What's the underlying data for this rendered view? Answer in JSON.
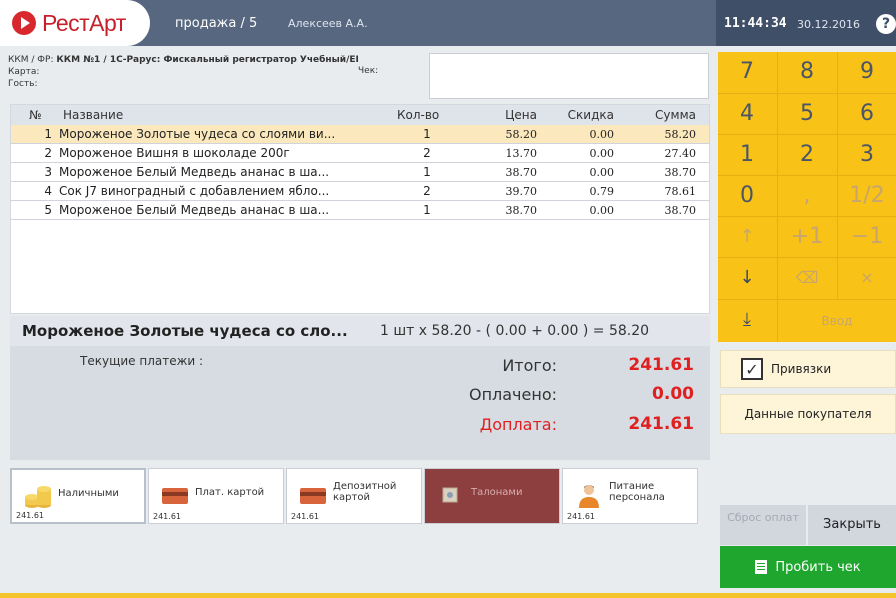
{
  "app": {
    "logo": "РестАрт",
    "mode": "продажа / 5",
    "cashier": "Алексеев А.А.",
    "time": "11:44:34",
    "date": "30.12.2016",
    "help": "?"
  },
  "info": {
    "kkm_label": "ККМ / ФР:",
    "kkm_value": "ККМ №1 / 1С-Рарус: Фискальный регистратор Учебный/EI",
    "card_label": "Карта:",
    "guest_label": "Гость:",
    "check_label": "Чек:"
  },
  "table": {
    "headers": [
      "№",
      "Название",
      "Кол-во",
      "Цена",
      "Скидка",
      "Сумма"
    ],
    "rows": [
      [
        "1",
        "Мороженое Золотые чудеса со слоями ви...",
        "1",
        "58.20",
        "0.00",
        "58.20"
      ],
      [
        "2",
        "Мороженое Вишня в шоколаде 200г",
        "2",
        "13.70",
        "0.00",
        "27.40"
      ],
      [
        "3",
        "Мороженое Белый Медведь ананас в ша...",
        "1",
        "38.70",
        "0.00",
        "38.70"
      ],
      [
        "4",
        "Сок J7 виноградный с добавлением ябло...",
        "2",
        "39.70",
        "0.79",
        "78.61"
      ],
      [
        "5",
        "Мороженое Белый Медведь ананас в ша...",
        "1",
        "38.70",
        "0.00",
        "38.70"
      ]
    ]
  },
  "selected": {
    "name": "Мороженое Золотые чудеса со сло...",
    "calc": "1 шт x 58.20 - ( 0.00 + 0.00 ) = 58.20"
  },
  "totals": {
    "current_payments": "Текущие платежи :",
    "total_label": "Итого:",
    "total_value": "241.61",
    "paid_label": "Оплачено:",
    "paid_value": "0.00",
    "due_label": "Доплата:",
    "due_value": "241.61"
  },
  "payments": [
    {
      "label": "Наличными",
      "amount": "241.61"
    },
    {
      "label": "Плат. картой",
      "amount": "241.61"
    },
    {
      "label": "Депозитной картой",
      "amount": "241.61"
    },
    {
      "label": "Талонами",
      "amount": ""
    },
    {
      "label": "Питание персонала",
      "amount": "241.61"
    }
  ],
  "numpad": {
    "keys": [
      "7",
      "8",
      "9",
      "4",
      "5",
      "6",
      "1",
      "2",
      "3",
      "0",
      ",",
      "1/2",
      "↑",
      "+1",
      "−1",
      "↓",
      "⌫",
      "×",
      "⤓"
    ],
    "enter": "Ввод"
  },
  "side": {
    "bindings": "Привязки",
    "buyer": "Данные покупателя",
    "reset": "Сброс оплат",
    "close": "Закрыть",
    "print": "Пробить чек"
  },
  "colors": {
    "accent": "#f8c316",
    "header": "#56677f",
    "due": "#e02020",
    "print": "#1fa62e"
  }
}
